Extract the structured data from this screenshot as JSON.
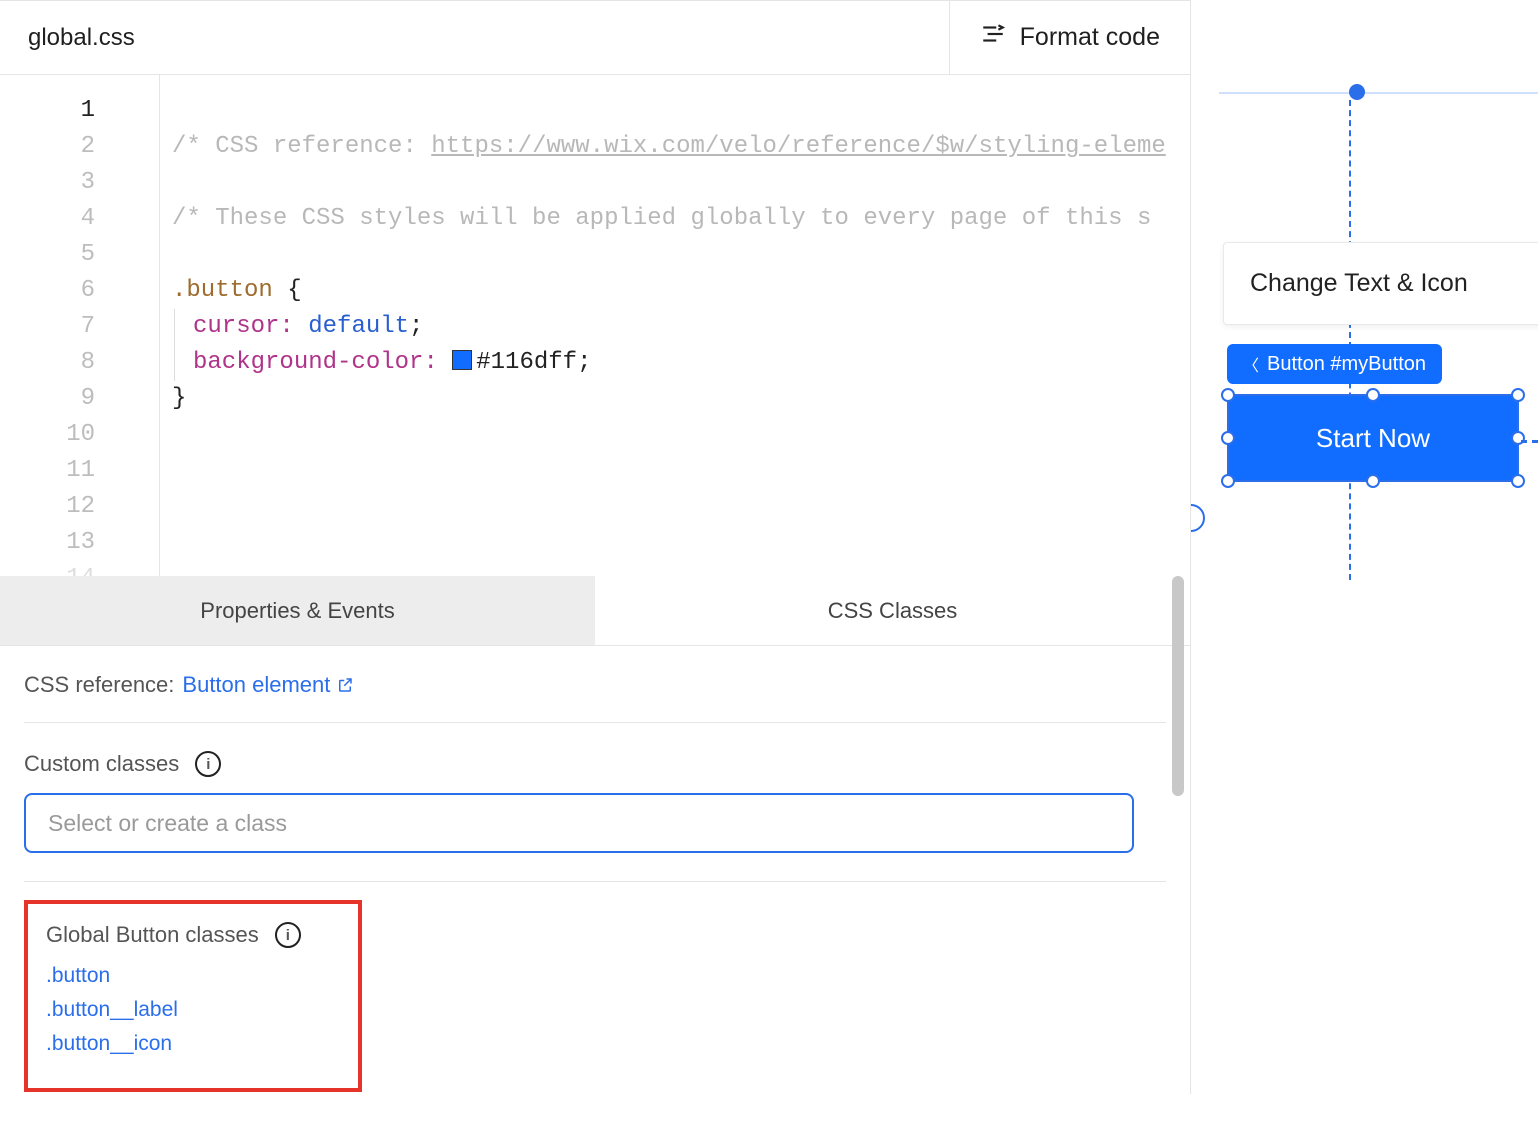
{
  "header": {
    "filename": "global.css",
    "format_label": "Format code"
  },
  "editor": {
    "line_count": 14,
    "active_line": 1,
    "line1_prefix": "/* CSS reference: ",
    "line1_link": "https://www.wix.com/velo/reference/$w/styling-eleme",
    "line3": "/* These CSS styles will be applied globally to every page of this s",
    "line5_sel": ".button",
    "line5_brace": " {",
    "line6_prop": "cursor:",
    "line6_val": " default",
    "line7_prop": "background-color:",
    "line7_hex": "#116dff",
    "line8_brace": "}",
    "swatch_color": "#116dff"
  },
  "tabs": {
    "t0": "Properties & Events",
    "t1": "CSS Classes",
    "active": 0
  },
  "css_ref": {
    "label": "CSS reference:",
    "link_text": "Button element"
  },
  "custom": {
    "label": "Custom classes",
    "placeholder": "Select or create a class"
  },
  "global": {
    "label": "Global Button classes",
    "items": [
      ".button",
      ".button__label",
      ".button__icon"
    ]
  },
  "preview": {
    "popover": "Change Text & Icon",
    "badge": "Button #myButton",
    "button_label": "Start Now"
  }
}
